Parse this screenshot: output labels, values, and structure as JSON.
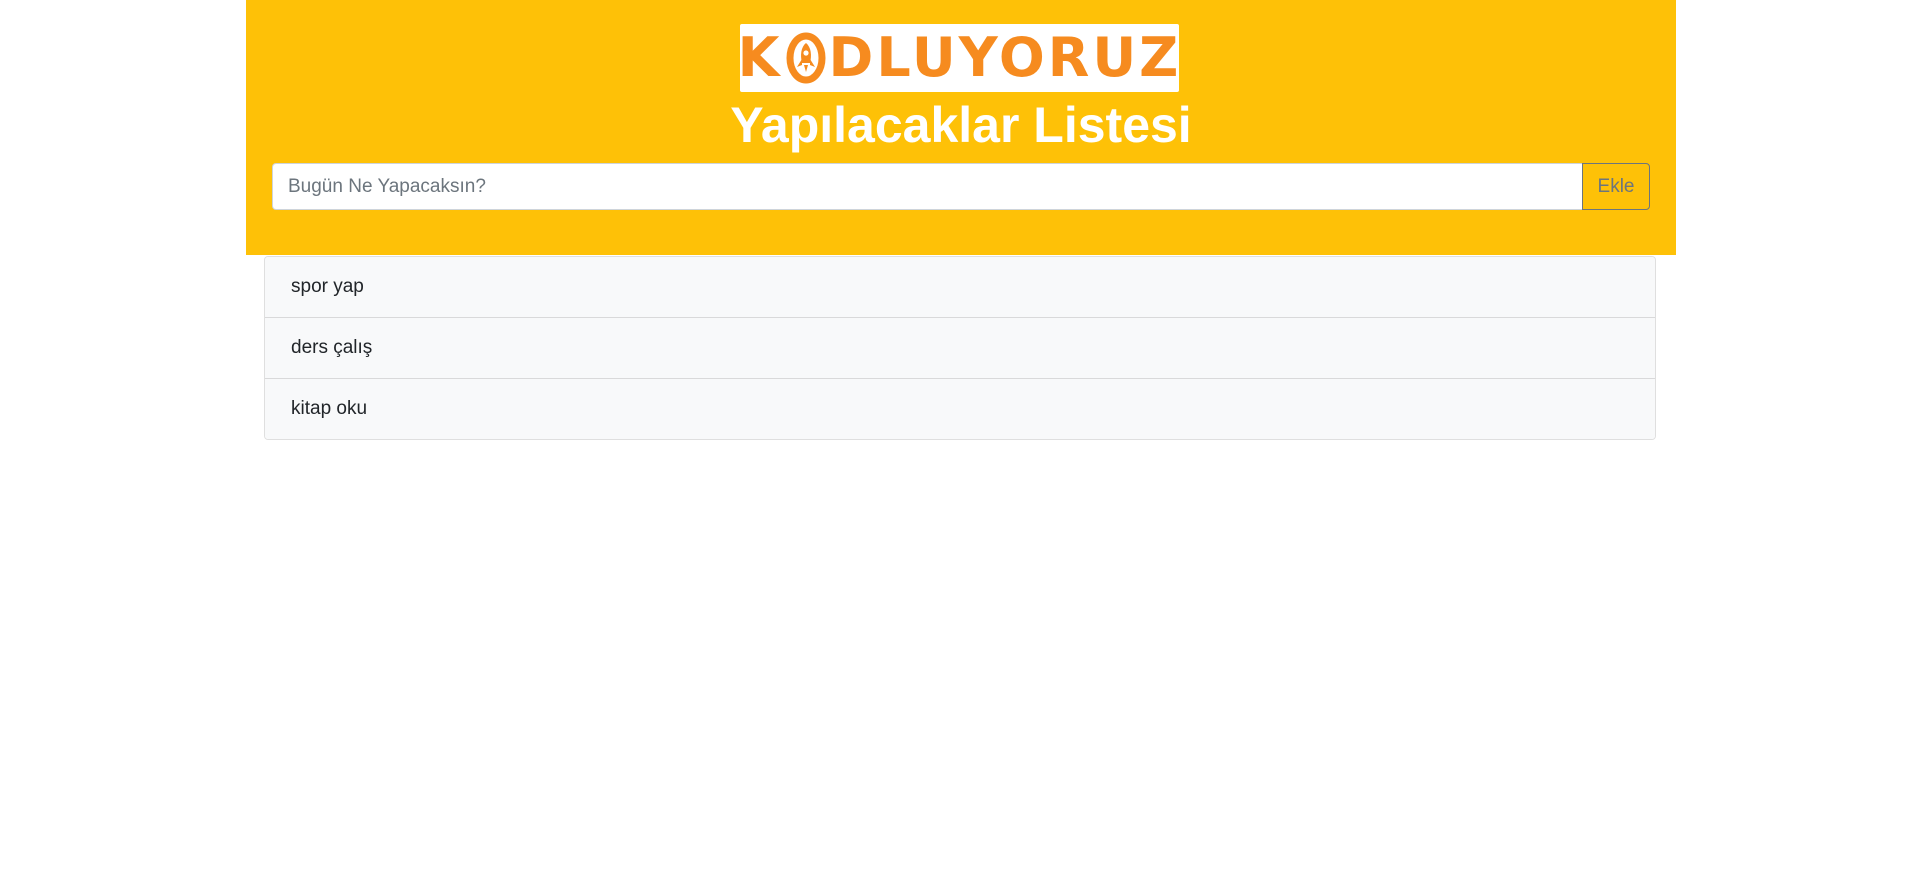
{
  "colors": {
    "accent": "#fec107",
    "brand": "#f68b1f"
  },
  "header": {
    "logo": {
      "text_before": "K",
      "icon": "rocket-o-icon",
      "text_after": "DLUYORUZ"
    },
    "title": "Yapılacaklar Listesi"
  },
  "task_form": {
    "input_value": "",
    "input_placeholder": "Bugün Ne Yapacaksın?",
    "add_button_label": "Ekle"
  },
  "tasks": [
    {
      "label": "spor yap"
    },
    {
      "label": "ders çalış"
    },
    {
      "label": "kitap oku"
    }
  ]
}
